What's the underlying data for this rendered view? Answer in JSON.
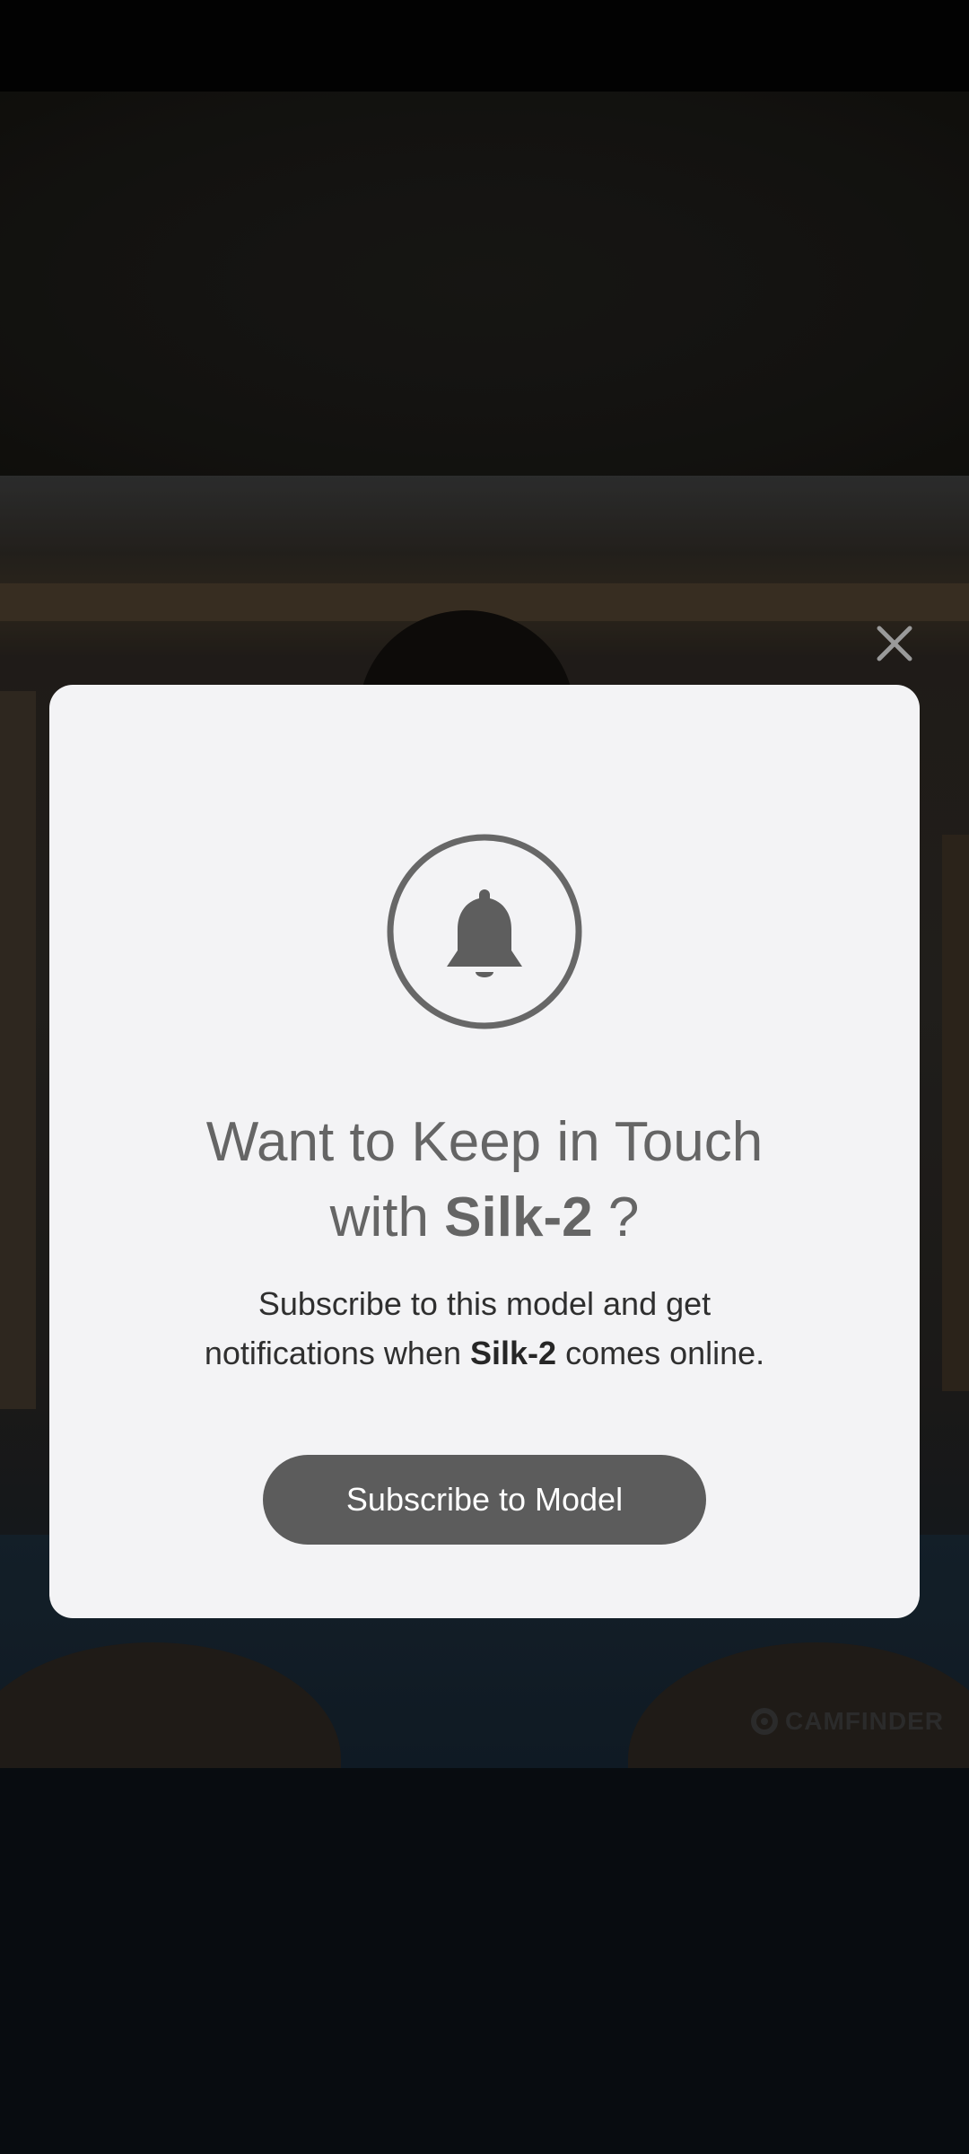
{
  "modal": {
    "title_prefix": "Want to Keep in Touch",
    "title_with": "with",
    "model_name": "Silk-2",
    "title_suffix": "?",
    "desc_line1": "Subscribe to this model and get",
    "desc_prefix": "notifications when",
    "desc_suffix": "comes online.",
    "subscribe_label": "Subscribe to Model"
  },
  "watermark": {
    "brand": "CAMFINDER"
  },
  "icons": {
    "close": "close-icon",
    "bell": "bell-icon",
    "logo": "camfinder-logo-icon"
  },
  "colors": {
    "modal_bg": "#f3f3f5",
    "title_text": "#656565",
    "button_bg": "#5c5c5c",
    "button_text": "#ffffff",
    "close_icon": "#9a9a9a"
  }
}
